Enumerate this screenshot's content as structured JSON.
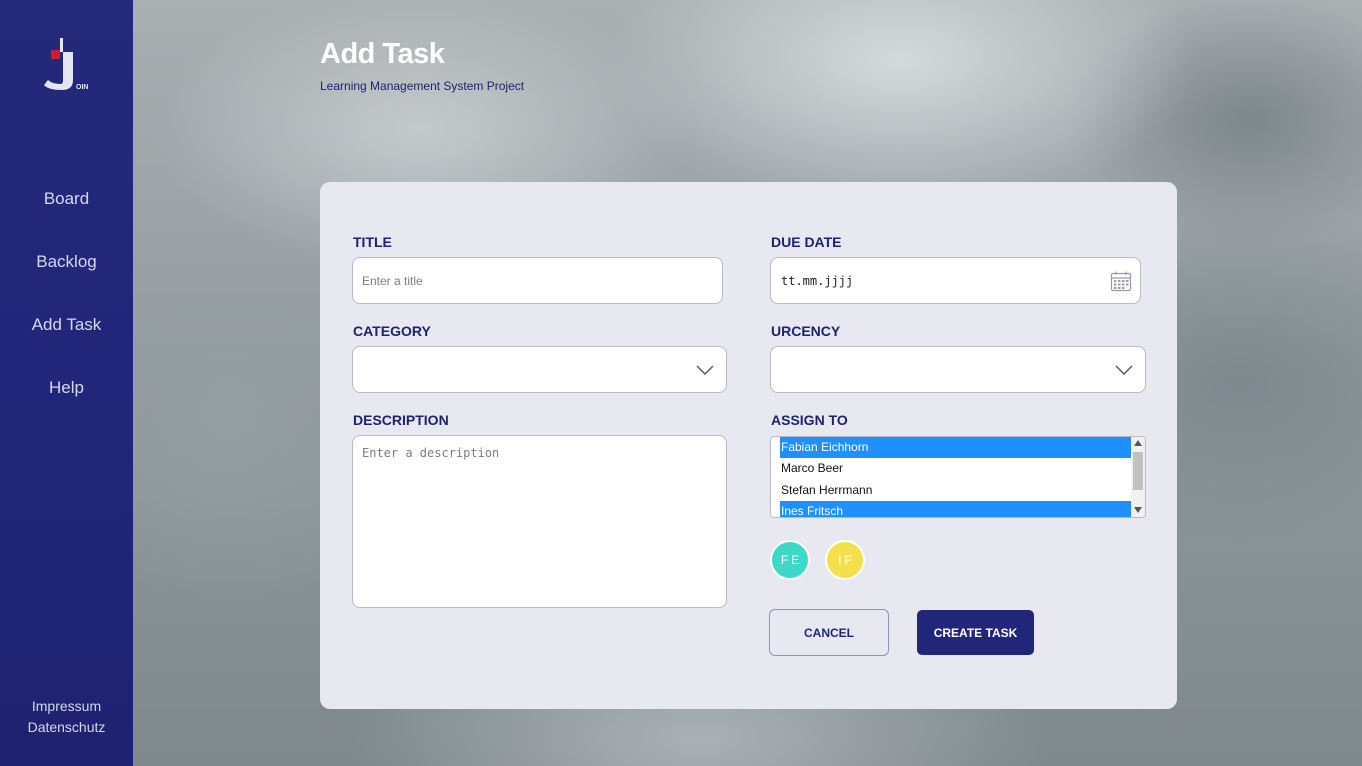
{
  "sidebar": {
    "logo_text": "OIN",
    "items": [
      {
        "label": "Board"
      },
      {
        "label": "Backlog"
      },
      {
        "label": "Add Task"
      },
      {
        "label": "Help"
      }
    ],
    "footer": {
      "impressum": "Impressum",
      "datenschutz": "Datenschutz"
    }
  },
  "header": {
    "title": "Add Task",
    "subtitle": "Learning Management System Project"
  },
  "form": {
    "title": {
      "label": "TITLE",
      "placeholder": "Enter a title",
      "value": ""
    },
    "due_date": {
      "label": "DUE DATE",
      "value": "tt.mm.jjjj"
    },
    "category": {
      "label": "CATEGORY",
      "value": ""
    },
    "urgency": {
      "label": "URCENCY",
      "value": ""
    },
    "description": {
      "label": "DESCRIPTION",
      "placeholder": "Enter a description"
    },
    "assign_to": {
      "label": "ASSIGN TO",
      "options": [
        {
          "name": "Fabian Eichhorn",
          "selected": true
        },
        {
          "name": "Marco Beer",
          "selected": false
        },
        {
          "name": "Stefan Herrmann",
          "selected": false
        },
        {
          "name": "Ines Fritsch",
          "selected": true
        }
      ]
    },
    "avatars": [
      {
        "initials": "FE",
        "color": "#3dd9c8"
      },
      {
        "initials": "IF",
        "color": "#f4e04d"
      }
    ],
    "cancel_label": "CANCEL",
    "create_label": "CREATE TASK"
  },
  "colors": {
    "sidebar": "#22267a",
    "accent": "#1e2270",
    "selection": "#1e90ff"
  }
}
